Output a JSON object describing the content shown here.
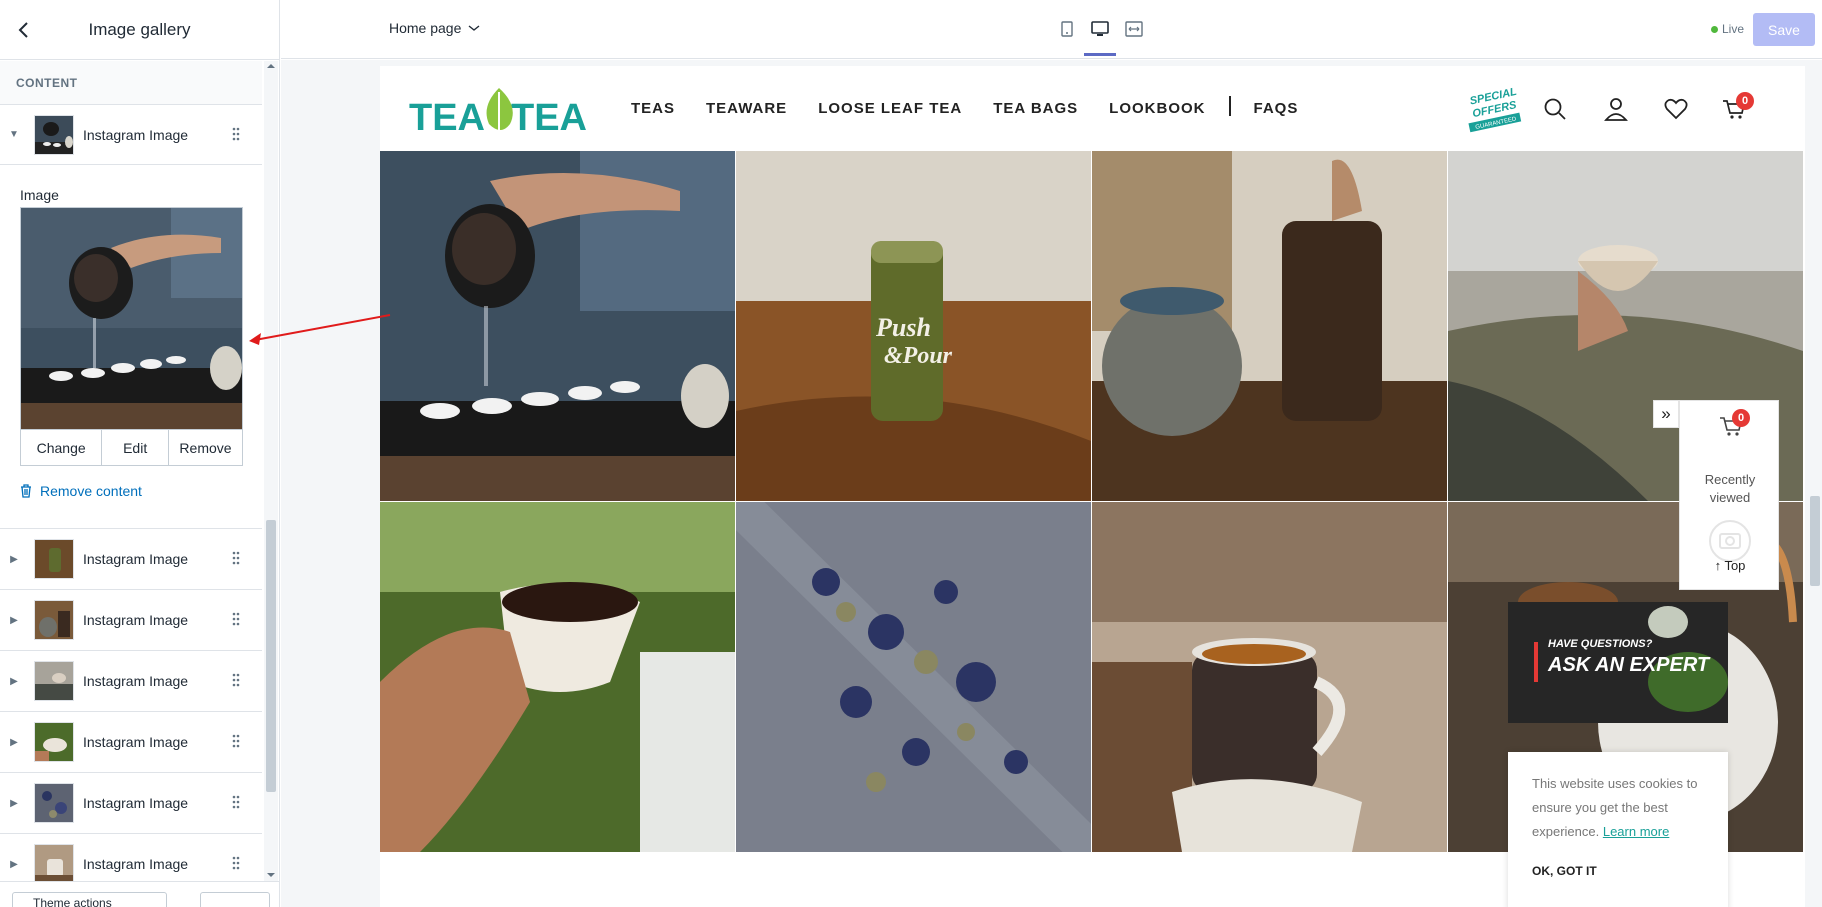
{
  "sidebar": {
    "title": "Image gallery",
    "section_label": "CONTENT",
    "expanded_block": {
      "label": "Instagram Image",
      "image_field_label": "Image",
      "buttons": [
        "Change",
        "Edit",
        "Remove"
      ],
      "remove_content": "Remove content"
    },
    "blocks": [
      {
        "label": "Instagram Image"
      },
      {
        "label": "Instagram Image"
      },
      {
        "label": "Instagram Image"
      },
      {
        "label": "Instagram Image"
      },
      {
        "label": "Instagram Image"
      },
      {
        "label": "Instagram Image"
      }
    ],
    "footer_button": "Theme actions"
  },
  "topbar": {
    "page_selector": "Home page",
    "live_label": "Live",
    "save_label": "Save",
    "device_icons": [
      "mobile-icon",
      "desktop-icon",
      "fullscreen-icon"
    ],
    "active_device": "desktop-icon"
  },
  "store": {
    "logo_text": "TEA TEA",
    "nav": [
      "TEAS",
      "TEAWARE",
      "LOOSE LEAF TEA",
      "TEA BAGS",
      "LOOKBOOK",
      "FAQS"
    ],
    "special_offers": [
      "SPECIAL",
      "OFFERS",
      "GUARANTEED"
    ],
    "cart_count": "0",
    "recently_viewed": {
      "count": "0",
      "label_line1": "Recently",
      "label_line2": "viewed",
      "top_label": "Top"
    },
    "ask_expert": {
      "line1": "HAVE QUESTIONS?",
      "line2": "ASK AN EXPERT"
    },
    "cookie": {
      "text": "This website uses cookies to ensure you get the best experience.",
      "link": "Learn more",
      "ok": "OK, GOT IT"
    },
    "gallery_images": [
      "pouring-tea-photo",
      "push-pour-can-photo",
      "teapot-photo",
      "cup-mountain-photo",
      "tea-cup-hand-photo",
      "loose-leaf-tea-photo",
      "mug-sweater-photo",
      "white-teapot-photo"
    ]
  },
  "colors": {
    "accent": "#5c6ac4",
    "save_disabled": "#b3bcf5",
    "link": "#006fbb",
    "brand_teal": "#19a098",
    "badge_red": "#e53935"
  }
}
